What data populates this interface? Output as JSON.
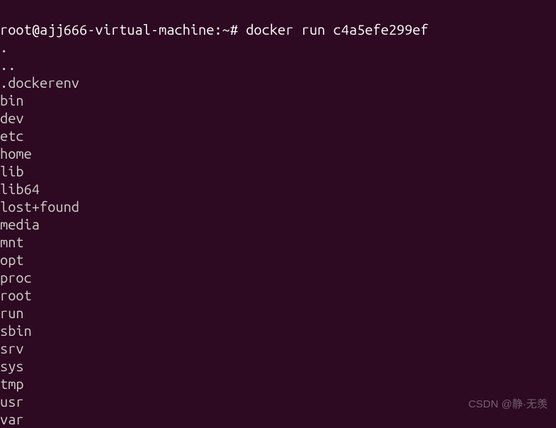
{
  "prompt": {
    "user_host": "root@ajj666-virtual-machine",
    "separator": ":",
    "path": "~",
    "symbol": "# "
  },
  "command": "docker run c4a5efe299ef",
  "output_lines": [
    ".",
    "..",
    ".dockerenv",
    "bin",
    "dev",
    "etc",
    "home",
    "lib",
    "lib64",
    "lost+found",
    "media",
    "mnt",
    "opt",
    "proc",
    "root",
    "run",
    "sbin",
    "srv",
    "sys",
    "tmp",
    "usr",
    "var"
  ],
  "watermark": "CSDN @静·无羡"
}
